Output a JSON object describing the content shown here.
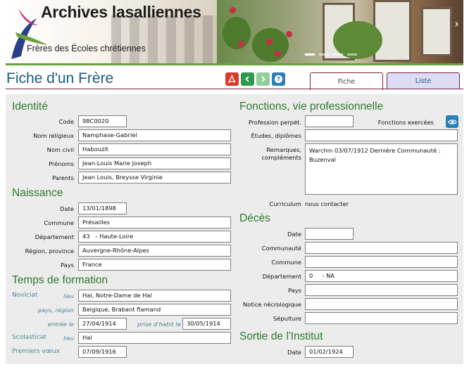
{
  "banner": {
    "title": "Archives lasalliennes",
    "subtitle": "Frères des Écoles chrétiennes"
  },
  "header": {
    "title": "Fiche d'un Frère",
    "tabs": {
      "fiche": "Fiche",
      "liste": "Liste"
    }
  },
  "identite": {
    "title": "Identité",
    "code_label": "Code",
    "code": "98C0020",
    "nom_religieux_label": "Nom religieux",
    "nom_religieux": "Namphase-Gabriel",
    "nom_civil_label": "Nom civil",
    "nom_civil": "Habouzit",
    "prenoms_label": "Prénoms",
    "prenoms": "Jean-Louis Marie Joseph",
    "parents_label": "Parents",
    "parents": "Jean Louis, Breysse Virginie"
  },
  "naissance": {
    "title": "Naissance",
    "date_label": "Date",
    "date": "13/01/1898",
    "commune_label": "Commune",
    "commune": "Présailles",
    "departement_label": "Département",
    "departement": "43   - Haute-Loire",
    "region_label": "Région, province",
    "region": "Auvergne-Rhône-Alpes",
    "pays_label": "Pays",
    "pays": "France"
  },
  "formation": {
    "title": "Temps de formation",
    "noviciat_label": "Noviciat",
    "lieu_label": "lieu",
    "noviciat_lieu": "Hal, Notre-Dame de Hal",
    "pays_region_label": "pays, région",
    "noviciat_pays": "Belgique, Brabant flamand",
    "entree_label": "entrée le",
    "entree": "27/04/1914",
    "prise_habit_label": "prise d'habit le",
    "prise_habit": "30/05/1914",
    "scolasticat_label": "Scolasticat",
    "scolasticat_lieu_label": "lieu",
    "scolasticat_lieu": "Hal",
    "premiers_voeux_label": "Premiers vœux",
    "premiers_voeux": "07/09/1916"
  },
  "fonctions": {
    "title": "Fonctions, vie professionnelle",
    "profession_label": "Profession perpét.",
    "profession": "",
    "fonctions_exercees_label": "Fonctions exercées",
    "etudes_label": "Études, diplômes",
    "etudes": "",
    "remarques_label_1": "Remarques,",
    "remarques_label_2": "compléments",
    "remarques_line1": "Warchin 03/07/1912 Dernière Communauté :",
    "remarques_line2": "Buzenval",
    "curriculum_label": "Curriculum",
    "curriculum": "nous contacter"
  },
  "deces": {
    "title": "Décès",
    "date_label": "Date",
    "date": "",
    "communaute_label": "Communauté",
    "communaute": "",
    "commune_label": "Commune",
    "commune": "",
    "departement_label": "Département",
    "departement": "0     - NA",
    "pays_label": "Pays",
    "pays": "",
    "notice_label": "Notice nécrologique",
    "notice": "",
    "sepulture_label": "Sépulture",
    "sepulture": ""
  },
  "sortie": {
    "title": "Sortie de l'Institut",
    "date_label": "Date",
    "date": "01/02/1924"
  },
  "colors": {
    "section_heading": "#2e7a2e",
    "title_blue": "#1f5a7a",
    "accent_green": "#6aa13a",
    "panel_bg": "#ececec",
    "icon_blue": "#2a7fb8"
  },
  "icons": {
    "pdf": "pdf-icon",
    "prev": "chevron-left-icon",
    "next": "chevron-right-icon",
    "help": "help-icon",
    "eye": "eye-icon",
    "logo": "logo-swoosh-icon",
    "slider_next": "chevron-right-icon"
  }
}
